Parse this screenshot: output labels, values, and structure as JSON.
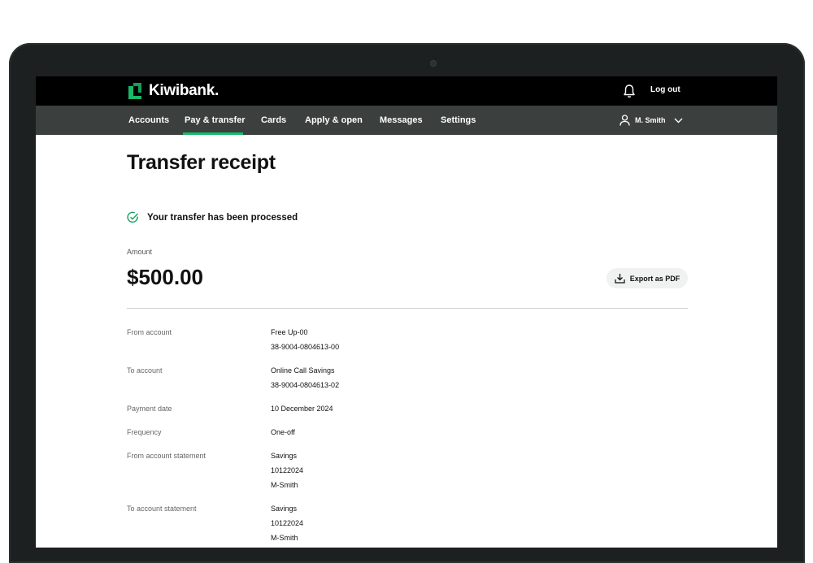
{
  "brand": {
    "name": "Kiwibank.",
    "accent": "#19b96b"
  },
  "topbar": {
    "logout_label": "Log out"
  },
  "nav": {
    "items": [
      {
        "label": "Accounts"
      },
      {
        "label": "Pay & transfer"
      },
      {
        "label": "Cards"
      },
      {
        "label": "Apply & open"
      },
      {
        "label": "Messages"
      },
      {
        "label": "Settings"
      }
    ],
    "active": "Pay & transfer",
    "user_name": "M. Smith"
  },
  "receipt": {
    "title": "Transfer receipt",
    "status_message": "Your transfer has been processed",
    "amount_label": "Amount",
    "amount_value": "$500.00",
    "export_label": "Export as PDF",
    "details": [
      {
        "label": "From account",
        "values": [
          "Free Up-00",
          "38-9004-0804613-00"
        ]
      },
      {
        "label": "To account",
        "values": [
          "Online Call Savings",
          "38-9004-0804613-02"
        ]
      },
      {
        "label": "Payment date",
        "values": [
          "10 December 2024"
        ]
      },
      {
        "label": "Frequency",
        "values": [
          "One-off"
        ]
      },
      {
        "label": "From account statement",
        "values": [
          "Savings",
          "10122024",
          "M-Smith"
        ]
      },
      {
        "label": "To account statement",
        "values": [
          "Savings",
          "10122024",
          "M-Smith"
        ]
      }
    ]
  },
  "icons": [
    "kiwibank-logo-icon",
    "bell-icon",
    "user-icon",
    "chevron-down-icon",
    "check-circle-icon",
    "download-icon"
  ]
}
